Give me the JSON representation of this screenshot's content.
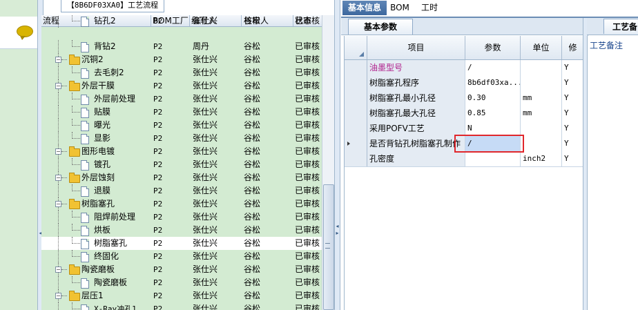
{
  "flow_panel": {
    "tab_title": "【8B6DF03XA0】工艺流程",
    "columns": [
      "流程",
      "BOM工厂",
      "编写人",
      "核审人",
      "状态"
    ],
    "rows": [
      {
        "level": 2,
        "type": "doc",
        "name": "钻孔2",
        "bom": "P2",
        "writer": "张仕兴",
        "reviewer": "谷松",
        "status": "已审核",
        "partial": true
      },
      {
        "level": 2,
        "type": "doc",
        "name": "背钻2",
        "bom": "P2",
        "writer": "周丹",
        "reviewer": "谷松",
        "status": "已审核"
      },
      {
        "level": 1,
        "type": "folder",
        "name": "沉铜2",
        "bom": "P2",
        "writer": "张仕兴",
        "reviewer": "谷松",
        "status": "已审核"
      },
      {
        "level": 2,
        "type": "doc",
        "name": "去毛刺2",
        "bom": "P2",
        "writer": "张仕兴",
        "reviewer": "谷松",
        "status": "已审核"
      },
      {
        "level": 1,
        "type": "folder",
        "name": "外层干膜",
        "bom": "P2",
        "writer": "张仕兴",
        "reviewer": "谷松",
        "status": "已审核"
      },
      {
        "level": 2,
        "type": "doc",
        "name": "外层前处理",
        "bom": "P2",
        "writer": "张仕兴",
        "reviewer": "谷松",
        "status": "已审核"
      },
      {
        "level": 2,
        "type": "doc",
        "name": "贴膜",
        "bom": "P2",
        "writer": "张仕兴",
        "reviewer": "谷松",
        "status": "已审核"
      },
      {
        "level": 2,
        "type": "doc",
        "name": "曝光",
        "bom": "P2",
        "writer": "张仕兴",
        "reviewer": "谷松",
        "status": "已审核"
      },
      {
        "level": 2,
        "type": "doc",
        "name": "显影",
        "bom": "P2",
        "writer": "张仕兴",
        "reviewer": "谷松",
        "status": "已审核"
      },
      {
        "level": 1,
        "type": "folder",
        "name": "图形电镀",
        "bom": "P2",
        "writer": "张仕兴",
        "reviewer": "谷松",
        "status": "已审核"
      },
      {
        "level": 2,
        "type": "doc",
        "name": "镀孔",
        "bom": "P2",
        "writer": "张仕兴",
        "reviewer": "谷松",
        "status": "已审核"
      },
      {
        "level": 1,
        "type": "folder",
        "name": "外层蚀刻",
        "bom": "P2",
        "writer": "张仕兴",
        "reviewer": "谷松",
        "status": "已审核"
      },
      {
        "level": 2,
        "type": "doc",
        "name": "退膜",
        "bom": "P2",
        "writer": "张仕兴",
        "reviewer": "谷松",
        "status": "已审核"
      },
      {
        "level": 1,
        "type": "folder",
        "name": "树脂塞孔",
        "bom": "P2",
        "writer": "张仕兴",
        "reviewer": "谷松",
        "status": "已审核"
      },
      {
        "level": 2,
        "type": "doc",
        "name": "阻焊前处理",
        "bom": "P2",
        "writer": "张仕兴",
        "reviewer": "谷松",
        "status": "已审核"
      },
      {
        "level": 2,
        "type": "doc",
        "name": "烘板",
        "bom": "P2",
        "writer": "张仕兴",
        "reviewer": "谷松",
        "status": "已审核"
      },
      {
        "level": 2,
        "type": "doc",
        "name": "树脂塞孔",
        "bom": "P2",
        "writer": "张仕兴",
        "reviewer": "谷松",
        "status": "已审核",
        "selected": true
      },
      {
        "level": 2,
        "type": "doc",
        "name": "终固化",
        "bom": "P2",
        "writer": "张仕兴",
        "reviewer": "谷松",
        "status": "已审核"
      },
      {
        "level": 1,
        "type": "folder",
        "name": "陶瓷磨板",
        "bom": "P2",
        "writer": "张仕兴",
        "reviewer": "谷松",
        "status": "已审核"
      },
      {
        "level": 2,
        "type": "doc",
        "name": "陶瓷磨板",
        "bom": "P2",
        "writer": "张仕兴",
        "reviewer": "谷松",
        "status": "已审核"
      },
      {
        "level": 1,
        "type": "folder",
        "name": "层压1",
        "bom": "P2",
        "writer": "张仕兴",
        "reviewer": "谷松",
        "status": "已审核"
      },
      {
        "level": 2,
        "type": "doc",
        "name": "X-Ray冲孔1",
        "bom": "P2",
        "writer": "张仕兴",
        "reviewer": "谷松",
        "status": "已审核"
      }
    ]
  },
  "main_tabs": [
    {
      "label": "基本信息",
      "active": true
    },
    {
      "label": "BOM",
      "active": false
    },
    {
      "label": "工时",
      "active": false
    }
  ],
  "param_panel": {
    "tab_label": "基本参数",
    "columns": [
      "项目",
      "参数",
      "单位",
      "修"
    ],
    "rows": [
      {
        "item": "油墨型号",
        "value": "/",
        "unit": "",
        "mod": "Y",
        "item_color": "#b0208c"
      },
      {
        "item": "树脂塞孔程序",
        "value": "8b6df03xa...",
        "unit": "",
        "mod": "Y"
      },
      {
        "item": "树脂塞孔最小孔径",
        "value": "0.30",
        "unit": "mm",
        "mod": "Y"
      },
      {
        "item": "树脂塞孔最大孔径",
        "value": "0.85",
        "unit": "mm",
        "mod": "Y"
      },
      {
        "item": "采用POFV工艺",
        "value": "N",
        "unit": "",
        "mod": "Y"
      },
      {
        "item": "是否背钻孔树脂塞孔制作",
        "value": "/",
        "unit": "",
        "mod": "Y",
        "current": true
      },
      {
        "item": "孔密度",
        "value": "",
        "unit": "inch2",
        "mod": "Y"
      }
    ]
  },
  "remark_panel": {
    "tab_label": "工艺备",
    "label": "工艺备注"
  },
  "colors": {
    "tree_bg": "#d3ebd2",
    "accent": "#3d689e",
    "highlight_red": "#e0262b"
  },
  "icons": {
    "chat": "chat-bubble-icon",
    "folder": "folder-icon",
    "doc": "document-icon"
  }
}
